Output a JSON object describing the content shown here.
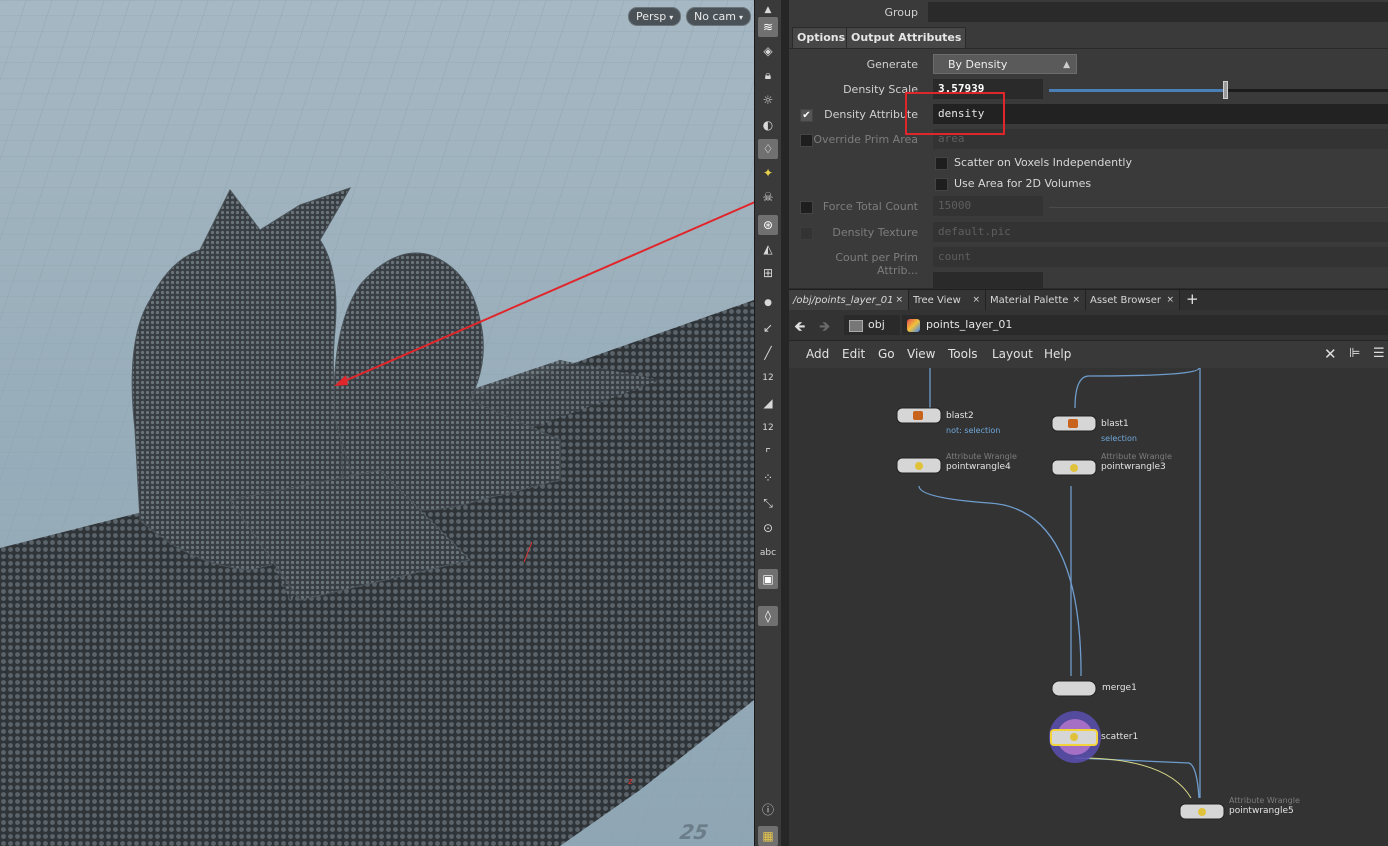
{
  "viewport": {
    "camera_persp": "Persp",
    "camera_nocam": "No cam",
    "floor_number": "25",
    "axis_z": "z"
  },
  "toolbar": {
    "icons": [
      "display-options-icon",
      "ghost-icon",
      "lock-icon",
      "bulb-icon",
      "shading-icon",
      "light-icon",
      "light-bulb-icon",
      "skull-icon",
      "render-icon",
      "template-icon",
      "snapshot-icon",
      "point-icon",
      "normal-icon",
      "brush-icon",
      "number-12-icon",
      "paint-icon",
      "number-12b-icon",
      "corner-icon",
      "grid-points-icon",
      "measure-icon",
      "circle-icon",
      "text-label-icon",
      "background-icon",
      "place-icon",
      "info-icon",
      "layout-icon"
    ],
    "number_label": "12",
    "number_label2": "12",
    "abc_label": "abc"
  },
  "params": {
    "group_label": "Group",
    "tabs": [
      "Options",
      "Output Attributes"
    ],
    "generate_label": "Generate",
    "generate_value": "By Density",
    "density_scale_label": "Density Scale",
    "density_scale_value": "3.57939",
    "density_scale_fraction": 0.52,
    "density_attribute_label": "Density Attribute",
    "density_attribute_value": "density",
    "override_prim_area_label": "Override Prim Area",
    "override_prim_area_value": "area",
    "scatter_on_voxels_label": "Scatter on Voxels Independently",
    "use_area_2d_label": "Use Area for 2D Volumes",
    "force_total_count_label": "Force Total Count",
    "force_total_count_value": "15000",
    "density_texture_label": "Density Texture",
    "density_texture_value": "default.pic",
    "count_per_prim_label": "Count per Prim Attrib...",
    "count_per_prim_value": "count"
  },
  "network": {
    "tabs": [
      {
        "label": "/obj/points_layer_01",
        "close": "×"
      },
      {
        "label": "Tree View",
        "close": "×"
      },
      {
        "label": "Material Palette",
        "close": "×"
      },
      {
        "label": "Asset Browser",
        "close": "×"
      }
    ],
    "add_tab": "+",
    "path": [
      "obj",
      "points_layer_01"
    ],
    "menu": [
      "Add",
      "Edit",
      "Go",
      "View",
      "Tools",
      "Layout",
      "Help"
    ],
    "nodes": [
      {
        "name": "blast2",
        "sub": "",
        "info": "not: selection"
      },
      {
        "name": "pointwrangle4",
        "sub": "Attribute Wrangle",
        "info": ""
      },
      {
        "name": "blast1",
        "sub": "",
        "info": "selection"
      },
      {
        "name": "pointwrangle3",
        "sub": "Attribute Wrangle",
        "info": ""
      },
      {
        "name": "merge1",
        "sub": "",
        "info": ""
      },
      {
        "name": "scatter1",
        "sub": "",
        "info": ""
      },
      {
        "name": "pointwrangle5",
        "sub": "Attribute Wrangle",
        "info": ""
      }
    ]
  },
  "colors": {
    "annotation_red": "#e0262a",
    "selected_node": "#f2d43a",
    "wire": "#6f9ccc",
    "viewport_sky": "#a6b8c3"
  }
}
